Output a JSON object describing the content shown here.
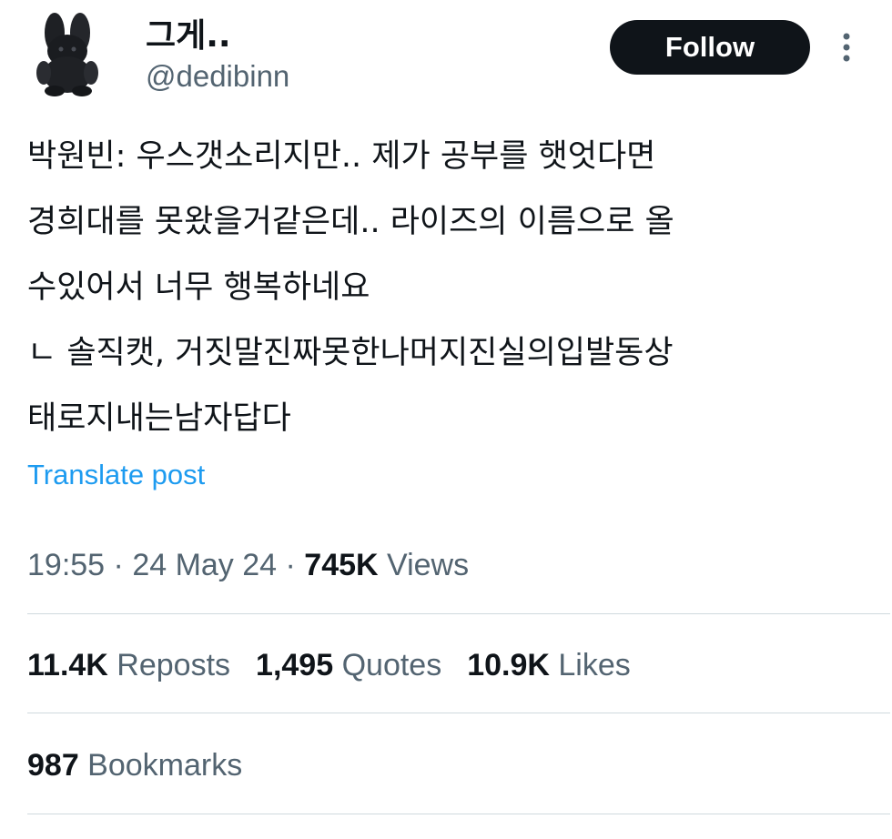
{
  "author": {
    "display_name": "그게..",
    "handle": "@dedibinn",
    "avatar_icon": "black-bunny-plush-avatar"
  },
  "actions": {
    "follow_label": "Follow",
    "more_icon": "more-vertical-icon"
  },
  "tweet": {
    "lines": [
      "박원빈: 우스갯소리지만.. 제가 공부를 햇엇다면",
      "경희대를 못왔을거같은데.. 라이즈의 이름으로 올",
      "수있어서 너무 행복하네요",
      "ㄴ 솔직캣, 거짓말진짜못한나머지진실의입발동상",
      "태로지내는남자답다"
    ],
    "translate_label": "Translate post"
  },
  "meta": {
    "time": "19:55",
    "separator": " · ",
    "date": "24 May 24",
    "views_count": "745K",
    "views_label": " Views"
  },
  "stats": {
    "reposts_count": "11.4K",
    "reposts_label": " Reposts",
    "quotes_count": "1,495",
    "quotes_label": " Quotes",
    "likes_count": "10.9K",
    "likes_label": " Likes",
    "bookmarks_count": "987",
    "bookmarks_label": " Bookmarks"
  },
  "colors": {
    "text_primary": "#0f1419",
    "text_secondary": "#536471",
    "link": "#1d9bf0",
    "divider": "#cfd9de",
    "button_bg": "#0f1419"
  }
}
